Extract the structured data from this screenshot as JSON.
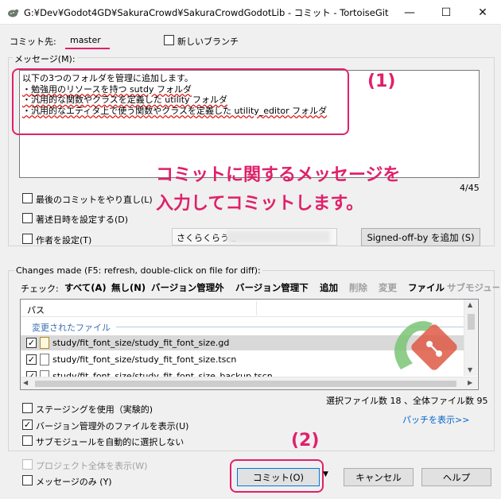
{
  "window": {
    "title": "G:¥Dev¥Godot4GD¥SakuraCrowd¥SakuraCrowdGodotLib - コミット - TortoiseGit",
    "minimize_glyph": "—",
    "maximize_glyph": "☐",
    "close_glyph": "✕"
  },
  "branch": {
    "label": "コミット先:",
    "value": "master",
    "new_branch_label": "新しいブランチ",
    "new_branch_checked": false
  },
  "message": {
    "label": "メッセージ(M):",
    "lines": [
      "以下の3つのフォルダを管理に追加します。",
      "・勉強用のリソースを持つ sutdy フォルダ",
      "・汎用的な関数やクラスを定義した utility フォルダ",
      "・汎用的なエディタ上で使う関数やクラスを定義した utility_editor フォルダ"
    ],
    "char_count": "4/45",
    "annotation_number": "(1)",
    "annotation_text_line1": "コミットに関するメッセージを",
    "annotation_text_line2": "入力してコミットします。"
  },
  "options": {
    "amend_label": "最後のコミットをやり直し(L)",
    "set_date_label": "著述日時を設定する(D)",
    "set_author_label": "作者を設定(T)",
    "author_value": "さくらくらうど",
    "signoff_button": "Signed-off-by を追加 (S)"
  },
  "changes": {
    "header": "Changes made (F5: refresh, double-click on file for diff):",
    "toolbar_label": "チェック:",
    "toolbar_items": [
      {
        "label": "すべて(A)",
        "enabled": true
      },
      {
        "label": "無し(N)",
        "enabled": true
      },
      {
        "label": "バージョン管理外",
        "enabled": true
      },
      {
        "label": "バージョン管理下",
        "enabled": true
      },
      {
        "label": "追加",
        "enabled": true
      },
      {
        "label": "削除",
        "enabled": false
      },
      {
        "label": "変更",
        "enabled": false
      },
      {
        "label": "ファイル",
        "enabled": true
      },
      {
        "label": "サブモジュー",
        "enabled": false
      }
    ],
    "column_path": "パス",
    "group_label": "変更されたファイル",
    "files": [
      {
        "path": "study/fit_font_size/study_fit_font_size.gd",
        "checked": true
      },
      {
        "path": "study/fit_font_size/study_fit_font_size.tscn",
        "checked": true
      },
      {
        "path": "study/fit_font_size/study_fit_font_size_backup.tscn",
        "checked": true
      }
    ],
    "summary": "選択ファイル数 18 、全体ファイル数 95",
    "show_patch": "パッチを表示>>"
  },
  "bottom_options": {
    "staging_label": "ステージングを使用（実験的)",
    "show_unversioned_label": "バージョン管理外のファイルを表示(U)",
    "show_unversioned_checked": true,
    "auto_submodule_label": "サブモジュールを自動的に選択しない",
    "whole_project_label": "プロジェクト全体を表示(W)",
    "message_only_label": "メッセージのみ (Y)"
  },
  "buttons": {
    "commit": "コミット(O)",
    "commit_dropdown": "▼",
    "cancel": "キャンセル",
    "help": "ヘルプ",
    "annotation_number": "(2)"
  },
  "colors": {
    "annotation": "#e0206a",
    "link": "#0066cc",
    "selected_row": "#d9d9d9"
  }
}
